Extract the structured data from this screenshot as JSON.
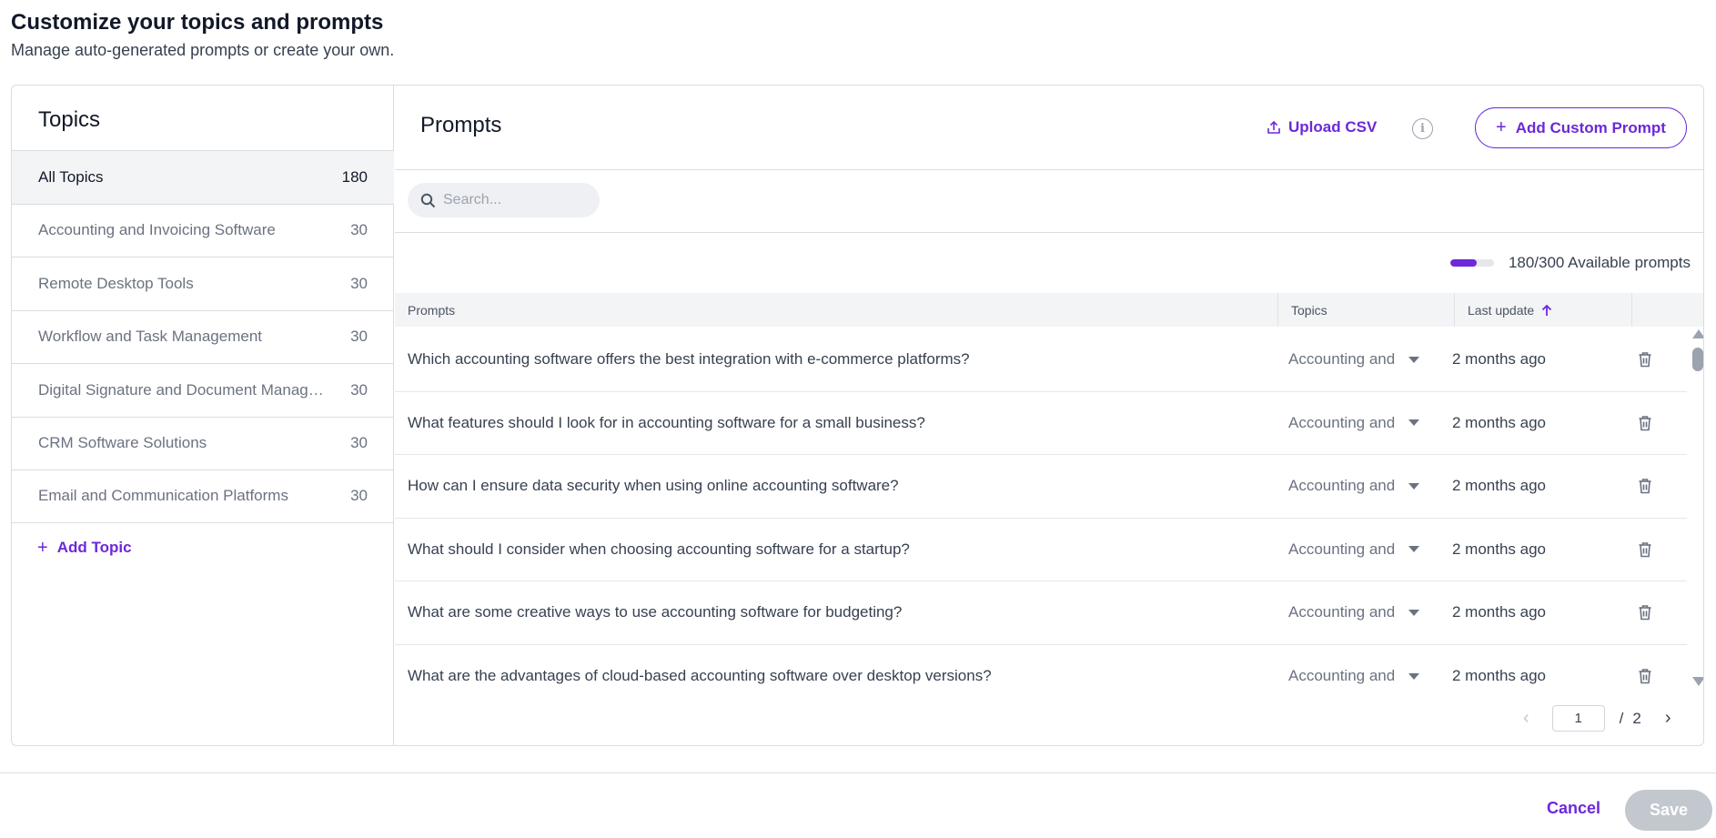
{
  "header": {
    "title": "Customize your topics and prompts",
    "subtitle": "Manage auto-generated prompts or create your own."
  },
  "topics": {
    "title": "Topics",
    "items": [
      {
        "label": "All Topics",
        "count": "180",
        "active": true
      },
      {
        "label": "Accounting and Invoicing Software",
        "count": "30"
      },
      {
        "label": "Remote Desktop Tools",
        "count": "30"
      },
      {
        "label": "Workflow and Task Management",
        "count": "30"
      },
      {
        "label": "Digital Signature and Document Manage...",
        "count": "30"
      },
      {
        "label": "CRM Software Solutions",
        "count": "30"
      },
      {
        "label": "Email and Communication Platforms",
        "count": "30"
      }
    ],
    "add_label": "Add Topic"
  },
  "prompts": {
    "title": "Prompts",
    "upload_label": "Upload CSV",
    "add_custom_label": "Add Custom Prompt",
    "search_placeholder": "Search...",
    "available_text": "180/300 Available prompts",
    "available_fraction": 0.6,
    "columns": {
      "prompts": "Prompts",
      "topics": "Topics",
      "last_update": "Last update"
    },
    "rows": [
      {
        "prompt": "Which accounting software offers the best integration with e-commerce platforms?",
        "topic": "Accounting and Invoicing Software",
        "updated": "2 months ago"
      },
      {
        "prompt": "What features should I look for in accounting software for a small business?",
        "topic": "Accounting and Invoicing Software",
        "updated": "2 months ago"
      },
      {
        "prompt": "How can I ensure data security when using online accounting software?",
        "topic": "Accounting and Invoicing Software",
        "updated": "2 months ago"
      },
      {
        "prompt": "What should I consider when choosing accounting software for a startup?",
        "topic": "Accounting and Invoicing Software",
        "updated": "2 months ago"
      },
      {
        "prompt": "What are some creative ways to use accounting software for budgeting?",
        "topic": "Accounting and Invoicing Software",
        "updated": "2 months ago"
      },
      {
        "prompt": "What are the advantages of cloud-based accounting software over desktop versions?",
        "topic": "Accounting and Invoicing Software",
        "updated": "2 months ago"
      }
    ],
    "pagination": {
      "current": "1",
      "separator": "/",
      "total": "2"
    }
  },
  "footer": {
    "cancel_label": "Cancel",
    "save_label": "Save"
  },
  "colors": {
    "accent": "#6d28d9",
    "disabled": "#c3c7ce",
    "border": "#d9dce1"
  },
  "icons": {
    "upload": "upload-icon",
    "info": "info-icon",
    "search": "search-icon",
    "delete": "trash-icon",
    "sort": "arrow-up-icon",
    "dropdown": "caret-down-icon"
  }
}
